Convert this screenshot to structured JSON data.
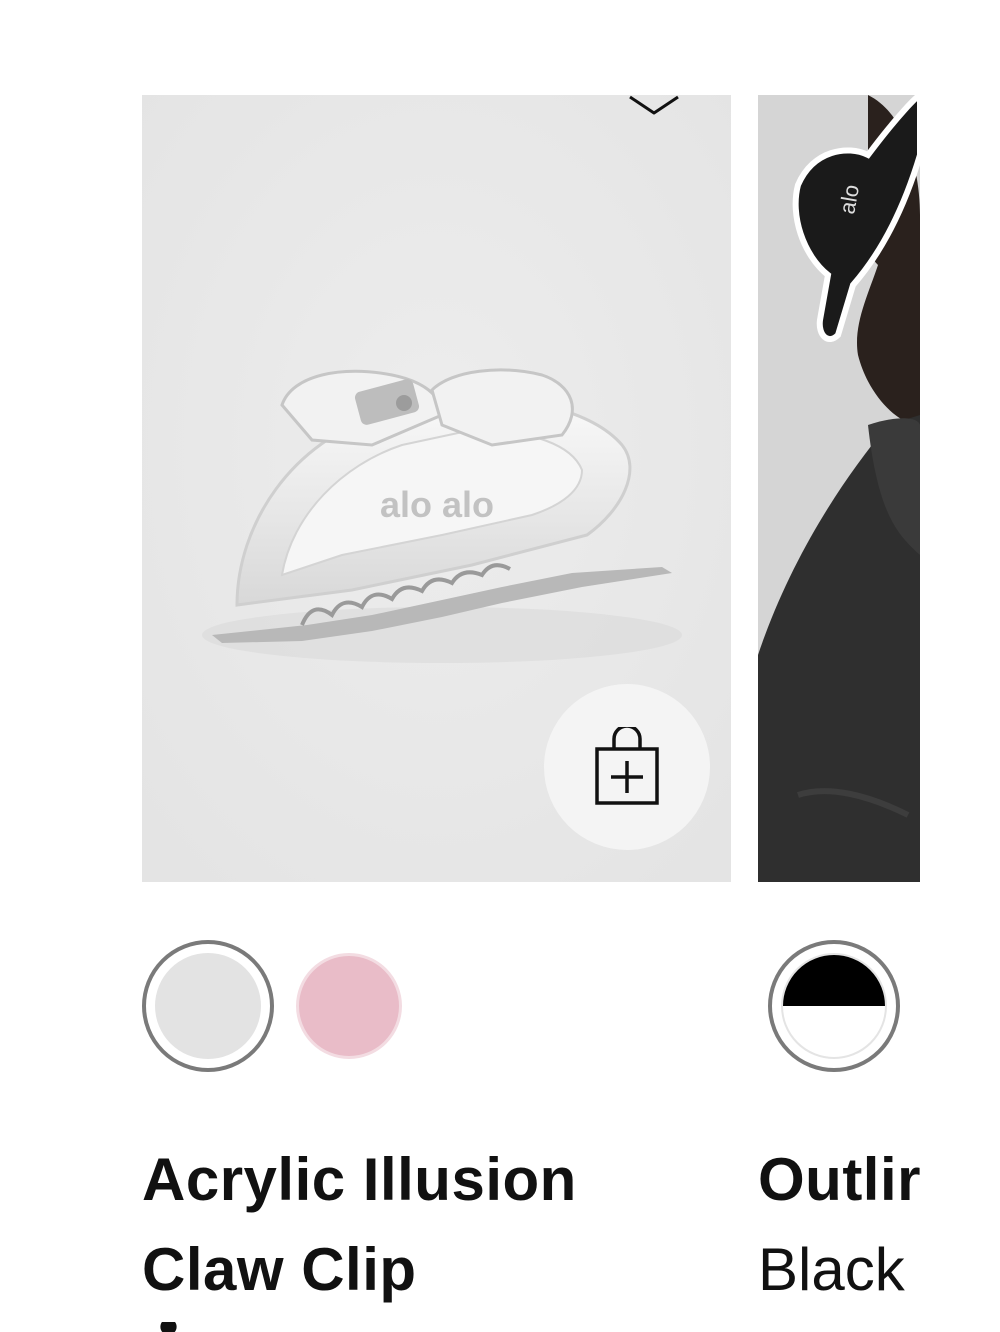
{
  "products": [
    {
      "name_line1": "Acrylic Illusion",
      "name_line2": "Claw Clip",
      "image_logo_text": "alo alo",
      "swatches": [
        {
          "color": "#e3e3e3",
          "selected": true
        },
        {
          "color": "#e9bcc8",
          "selected": false
        }
      ],
      "wishlist_icon": "heart-icon",
      "add_icon": "shopping-bag-plus-icon"
    },
    {
      "name": "Outlir",
      "variant": "Black",
      "image_logo_text": "alo",
      "swatches": [
        {
          "color_top": "#000000",
          "color_bottom": "#ffffff",
          "selected": true
        }
      ]
    }
  ]
}
